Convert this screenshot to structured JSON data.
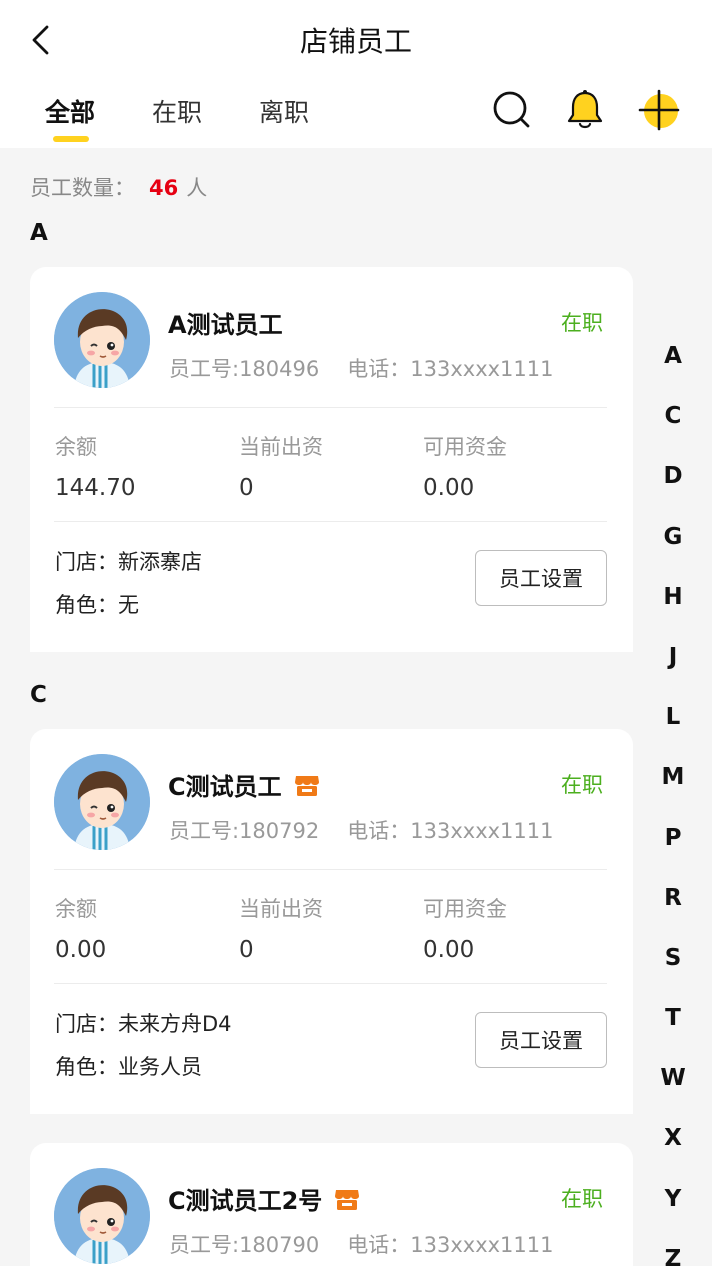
{
  "header": {
    "title": "店铺员工",
    "back_icon": "chevron-left-icon"
  },
  "tabs": [
    {
      "label": "全部",
      "active": true
    },
    {
      "label": "在职",
      "active": false
    },
    {
      "label": "离职",
      "active": false
    }
  ],
  "actions": {
    "search_icon": "search-icon",
    "bell_icon": "bell-icon",
    "add_icon": "plus-icon"
  },
  "summary": {
    "label": "员工数量：",
    "count": "46",
    "unit": "人"
  },
  "sections": [
    {
      "letter": "A",
      "employees": [
        {
          "name": "A测试员工",
          "store_badge": false,
          "status": "在职",
          "emp_no": "员工号:180496",
          "phone": "电话：133xxxx1111",
          "balance_label": "余额",
          "balance": "144.70",
          "investment_label": "当前出资",
          "investment": "0",
          "available_label": "可用资金",
          "available": "0.00",
          "store": "门店：新添寨店",
          "role": "角色：无",
          "button": "员工设置"
        }
      ]
    },
    {
      "letter": "C",
      "employees": [
        {
          "name": "C测试员工",
          "store_badge": true,
          "status": "在职",
          "emp_no": "员工号:180792",
          "phone": "电话：133xxxx1111",
          "balance_label": "余额",
          "balance": "0.00",
          "investment_label": "当前出资",
          "investment": "0",
          "available_label": "可用资金",
          "available": "0.00",
          "store": "门店：未来方舟D4",
          "role": "角色：业务人员",
          "button": "员工设置"
        },
        {
          "name": "C测试员工2号",
          "store_badge": true,
          "status": "在职",
          "emp_no": "员工号:180790",
          "phone": "电话：133xxxx1111"
        }
      ]
    }
  ],
  "index_letters": [
    "A",
    "C",
    "D",
    "G",
    "H",
    "J",
    "L",
    "M",
    "P",
    "R",
    "S",
    "T",
    "W",
    "X",
    "Y",
    "Z"
  ],
  "colors": {
    "accent": "#ffd21f",
    "status_green": "#4caf1f",
    "count_red": "#e60012",
    "store_badge": "#f07a17"
  }
}
